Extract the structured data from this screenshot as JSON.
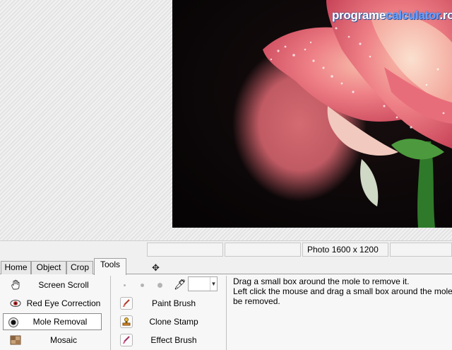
{
  "watermark": {
    "part1": "programe",
    "part2": "calculator",
    "part3": ".ro"
  },
  "status": {
    "cell1": "",
    "cell2": "",
    "cell3": "Photo 1600 x 1200",
    "cell4": ""
  },
  "tabs": [
    {
      "label": "Home"
    },
    {
      "label": "Object"
    },
    {
      "label": "Crop"
    },
    {
      "label": "Tools"
    }
  ],
  "active_tab": "Tools",
  "tools": [
    {
      "label": "Screen Scroll",
      "icon": "hand-icon"
    },
    {
      "label": "Red Eye Correction",
      "icon": "eye-icon"
    },
    {
      "label": "Mole Removal",
      "icon": "mole-icon",
      "selected": true
    },
    {
      "label": "Mosaic",
      "icon": "mosaic-icon"
    }
  ],
  "brushes": [
    {
      "label": "Paint Brush",
      "icon": "paint-brush-icon"
    },
    {
      "label": "Clone Stamp",
      "icon": "clone-stamp-icon"
    },
    {
      "label": "Effect Brush",
      "icon": "effect-brush-icon"
    }
  ],
  "brush_color": "#ffffff",
  "help": {
    "line1": "Drag a small box around the mole to remove it.",
    "line2": "Left click the mouse and drag a small box around the mole to",
    "line3": "be removed."
  }
}
